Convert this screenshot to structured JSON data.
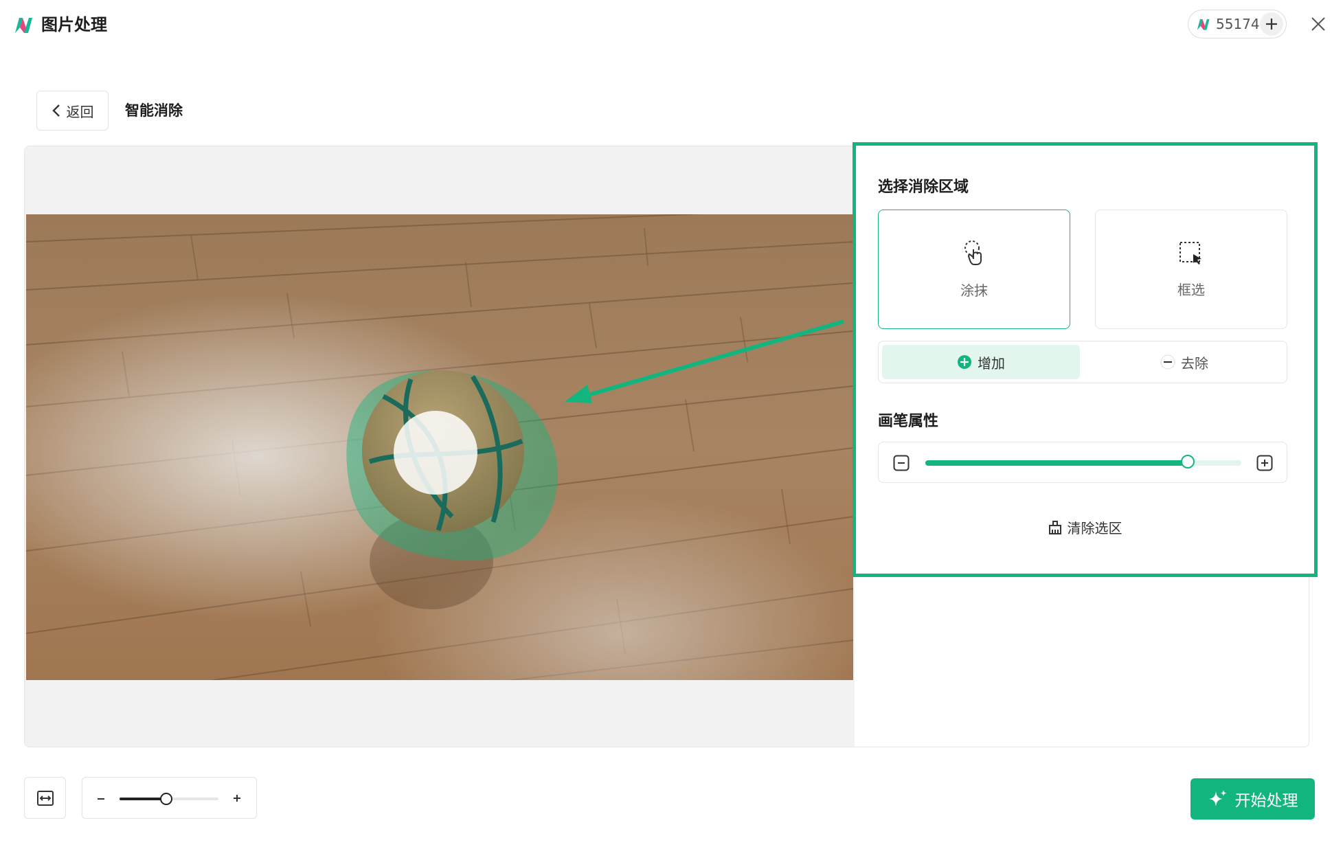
{
  "app": {
    "title": "图片处理",
    "credits": "55174"
  },
  "header": {
    "back_label": "返回",
    "page_title": "智能消除"
  },
  "panel": {
    "area_title": "选择消除区域",
    "modes": [
      {
        "label": "涂抹",
        "icon": "brush-select-icon",
        "selected": true
      },
      {
        "label": "框选",
        "icon": "box-select-icon",
        "selected": false
      }
    ],
    "add_label": "增加",
    "remove_label": "去除",
    "brush_title": "画笔属性",
    "brush_size_fraction": 0.83,
    "clear_label": "清除选区"
  },
  "bottom": {
    "zoom_fraction": 0.47,
    "start_label": "开始处理"
  },
  "colors": {
    "accent": "#13b57f",
    "accent_light": "#e3f6ee"
  }
}
